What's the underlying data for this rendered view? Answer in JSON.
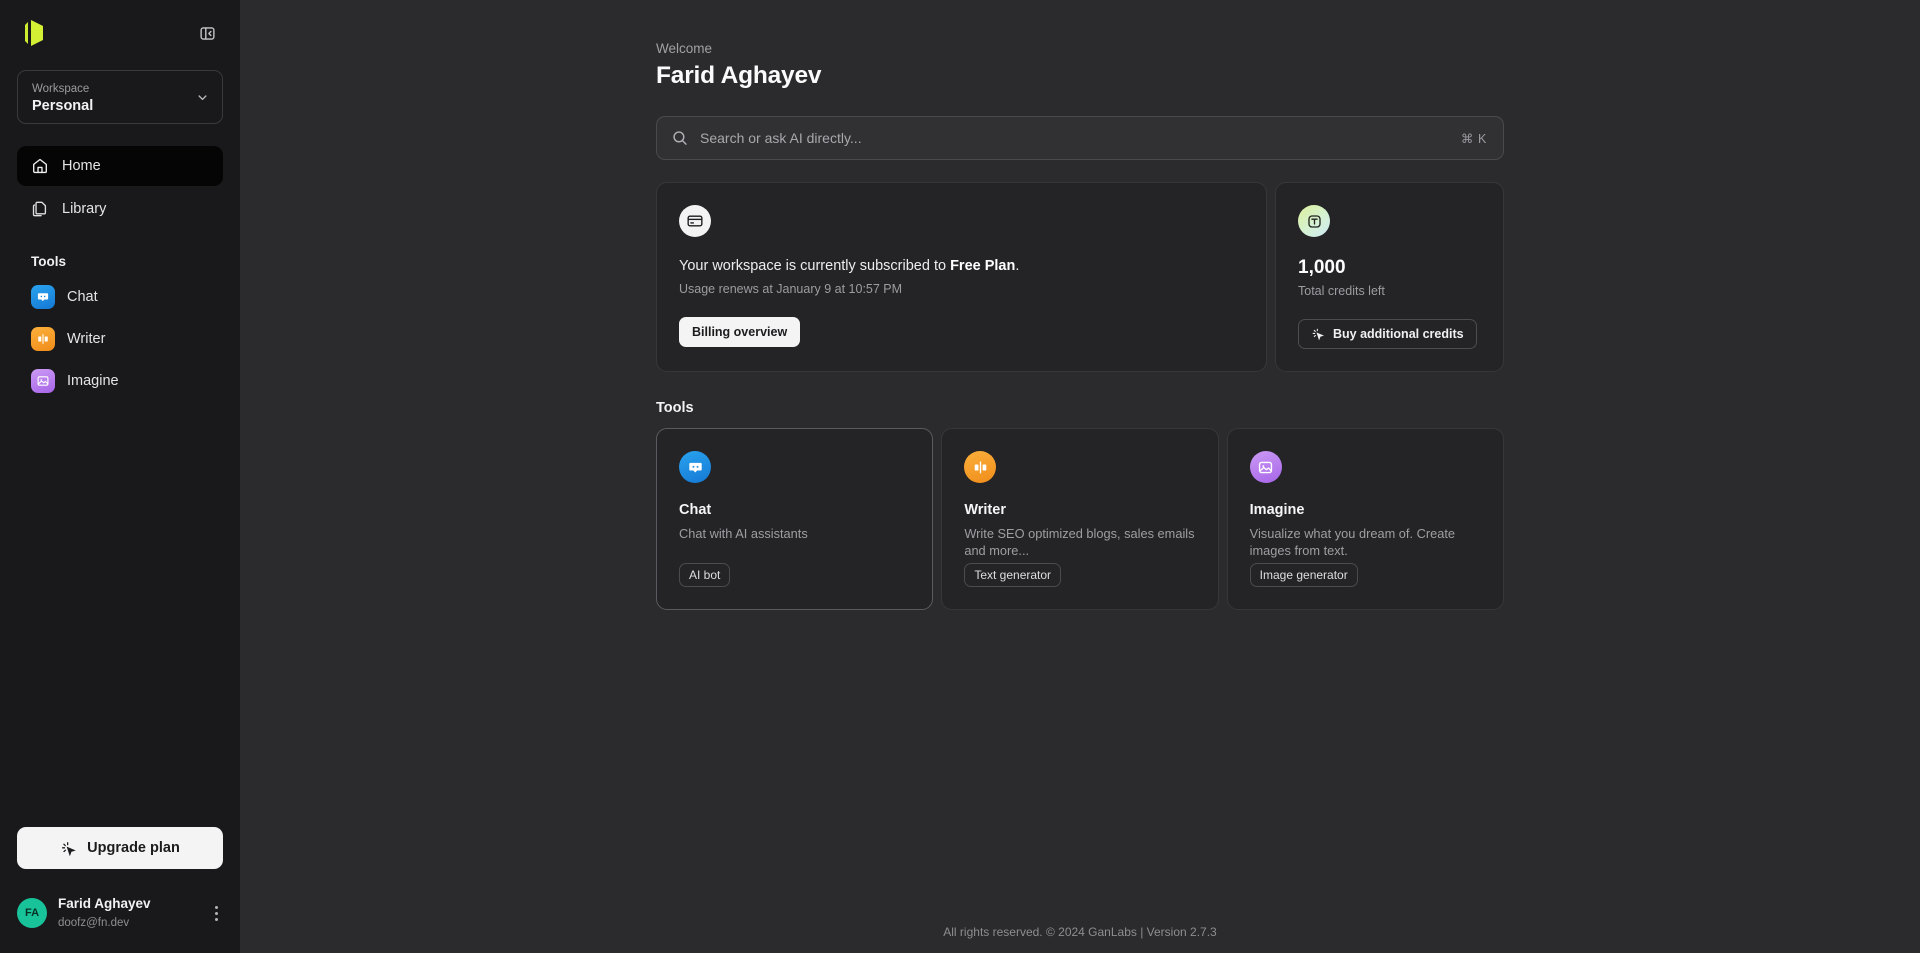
{
  "sidebar": {
    "logo_icon": "ganlabs-logo-icon",
    "collapse_icon": "panel-collapse-icon",
    "workspace": {
      "label": "Workspace",
      "value": "Personal",
      "chevron_icon": "chevron-down-icon"
    },
    "nav": [
      {
        "label": "Home",
        "icon": "home-icon",
        "active": true
      },
      {
        "label": "Library",
        "icon": "library-icon",
        "active": false
      }
    ],
    "tools_heading": "Tools",
    "tools": [
      {
        "label": "Chat",
        "icon": "chat-icon",
        "color": "#1e8fe0"
      },
      {
        "label": "Writer",
        "icon": "writer-icon",
        "color": "#f59e20"
      },
      {
        "label": "Imagine",
        "icon": "imagine-icon",
        "color": "#b478ee"
      }
    ],
    "upgrade": {
      "label": "Upgrade plan",
      "icon": "sparkle-cursor-icon"
    },
    "user": {
      "initials": "FA",
      "name": "Farid Aghayev",
      "email": "doofz@fn.dev",
      "menu_icon": "kebab-menu-icon"
    }
  },
  "main": {
    "welcome_label": "Welcome",
    "user_name": "Farid Aghayev",
    "search": {
      "placeholder": "Search or ask AI directly...",
      "shortcut": "⌘ K",
      "icon": "search-icon"
    },
    "plan_card": {
      "icon": "credit-card-icon",
      "text_prefix": "Your workspace is currently subscribed to ",
      "plan_name": "Free Plan",
      "text_suffix": ".",
      "renew_text": "Usage renews at January 9 at 10:57 PM",
      "button_label": "Billing overview"
    },
    "credits_card": {
      "icon": "token-icon",
      "amount": "1,000",
      "caption": "Total credits left",
      "button_label": "Buy additional credits",
      "button_icon": "sparkle-cursor-icon"
    },
    "tools_heading": "Tools",
    "tool_cards": [
      {
        "title": "Chat",
        "desc": "Chat with AI assistants",
        "tag": "AI bot",
        "icon": "chat-icon",
        "color": "#1e8fe0"
      },
      {
        "title": "Writer",
        "desc": "Write SEO optimized blogs, sales emails and more...",
        "tag": "Text generator",
        "icon": "writer-icon",
        "color": "#f59e20"
      },
      {
        "title": "Imagine",
        "desc": "Visualize what you dream of. Create images from text.",
        "tag": "Image generator",
        "icon": "imagine-icon",
        "color": "#b478ee"
      }
    ],
    "footer": "All rights reserved. © 2024 GanLabs | Version 2.7.3"
  },
  "colors": {
    "accent": "#d4f034",
    "background": "#2b2b2d",
    "sidebar": "#19191b",
    "card": "#242427"
  }
}
